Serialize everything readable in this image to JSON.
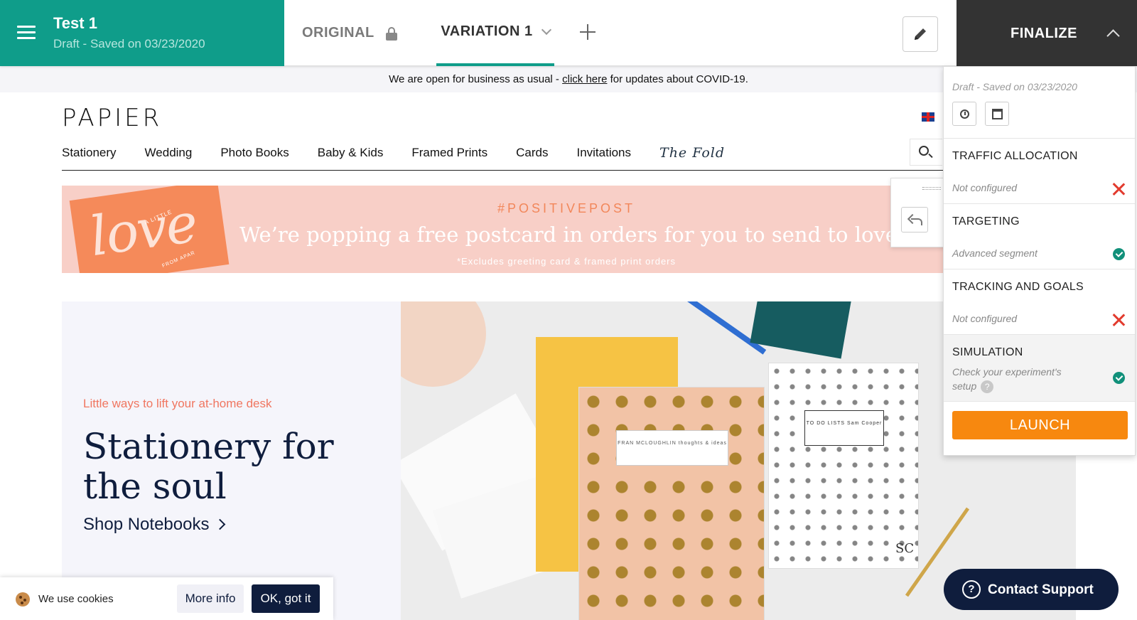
{
  "editor": {
    "test_title": "Test 1",
    "test_status": "Draft - Saved on 03/23/2020",
    "tabs": [
      {
        "label": "ORIGINAL"
      },
      {
        "label": "VARIATION 1"
      }
    ],
    "finalize_label": "FINALIZE"
  },
  "finalize_panel": {
    "saved": "Draft - Saved on 03/23/2020",
    "sections": [
      {
        "title": "TRAFFIC ALLOCATION",
        "status": "Not configured",
        "ok": false
      },
      {
        "title": "TARGETING",
        "status": "Advanced segment",
        "ok": true
      },
      {
        "title": "TRACKING AND GOALS",
        "status": "Not configured",
        "ok": false
      },
      {
        "title": "SIMULATION",
        "status": "Check your experiment's setup",
        "ok": true
      }
    ],
    "launch_label": "LAUNCH"
  },
  "site": {
    "covid": {
      "prefix": "We are open for business as usual - ",
      "link": "click here",
      "suffix": " for updates about COVID-19."
    },
    "logo": "PAPIER",
    "nav": [
      "Stationery",
      "Wedding",
      "Photo Books",
      "Baby & Kids",
      "Framed Prints",
      "Cards",
      "Invitations",
      "The Fold"
    ],
    "promo": {
      "hashtag": "#POSITIVEPOST",
      "headline": "We’re popping a free postcard in orders for you to send to loved ones",
      "note": "*Excludes greeting card & framed print orders",
      "card_script": "love",
      "card_top": "A LITTLE",
      "card_bottom": "FROM APAR"
    },
    "hero": {
      "tag": "Little ways to lift your at-home desk",
      "title": "Stationery for the soul",
      "link": "Shop Notebooks",
      "notebook1_label": "FRAN MCLOUGHLIN thoughts & ideas",
      "notebook2_label": "TO DO LISTS Sam Cooper",
      "notebook2_initials": "SC"
    }
  },
  "cookie": {
    "text": "We use cookies",
    "more_info": "More info",
    "ok": "OK, got it"
  },
  "support": {
    "label": "Contact Support"
  },
  "colors": {
    "brand_teal": "#0f9d8a",
    "launch_orange": "#f7880f",
    "navy": "#0f1d3d",
    "error_red": "#e23b2e",
    "success_green": "#11907a"
  }
}
